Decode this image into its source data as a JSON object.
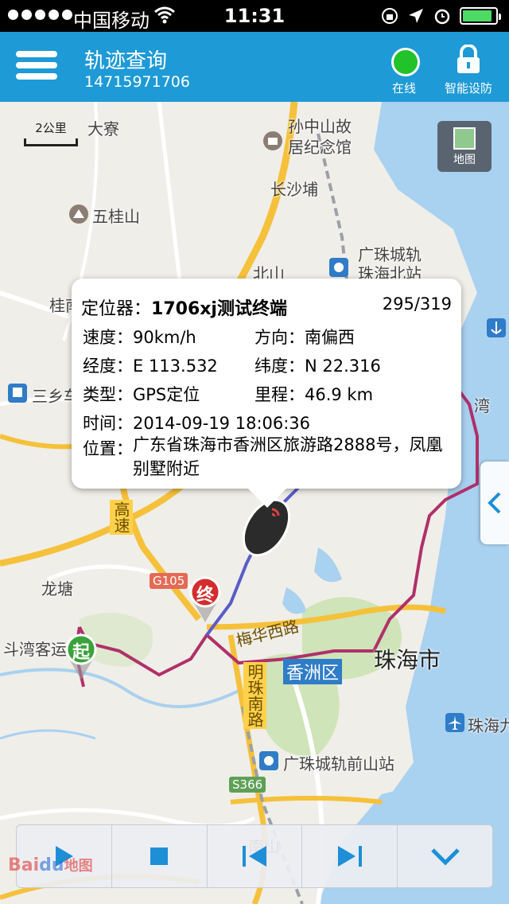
{
  "status_bar": {
    "carrier": "中国移动",
    "time": "11:31"
  },
  "header": {
    "title": "轨迹查询",
    "subtitle": "14715971706",
    "online_label": "在线",
    "defense_label": "智能设防"
  },
  "map": {
    "scale_label": "2公里",
    "map_type_label": "地图",
    "labels": {
      "dazhai": "大寮",
      "sunzhongshan": "孙中山故\n居纪念馆",
      "changshapu": "长沙埔",
      "wuguishan": "五桂山",
      "guangzhu_north": "广珠城轨\n珠海北站",
      "beishan": "北山",
      "guiyuan": "桂南",
      "sanxiang": "三乡车",
      "wan": "湾",
      "longtang": "龙塘",
      "doumen": "斗湾客运",
      "meihua": "梅华西路",
      "xiangzhou": "香洲区",
      "zhuhai_city": "珠海市",
      "mingzhu": "明珠南路",
      "qianshan_station": "广珠城轨前山站",
      "zhuhai_airport": "珠海九",
      "nanshan": "南山",
      "g105": "G105",
      "s366": "S366",
      "expressway": "高速"
    }
  },
  "popup": {
    "title_prefix": "定位器：",
    "device_name": "1706xj测试终端",
    "count": "295/319",
    "speed_label": "速度：",
    "speed": "90km/h",
    "direction_label": "方向：",
    "direction": "南偏西",
    "lng_label": "经度：",
    "lng": "E 113.532",
    "lat_label": "纬度：",
    "lat": "N 22.316",
    "type_label": "类型：",
    "type": "GPS定位",
    "mileage_label": "里程：",
    "mileage": "46.9 km",
    "time_label": "时间：",
    "time": "2014-09-19 18:06:36",
    "address_label": "位置：",
    "address": "广东省珠海市香洲区旅游路2888号，凤凰别墅附近"
  },
  "markers": {
    "start": "起",
    "end": "终"
  },
  "logo": {
    "brand": "Bai",
    "brand_tail": "地图"
  },
  "colors": {
    "header_bg": "#1e9ad6",
    "online": "#22c22a",
    "track": "#b0306a",
    "control_icon": "#1e8fd6"
  }
}
